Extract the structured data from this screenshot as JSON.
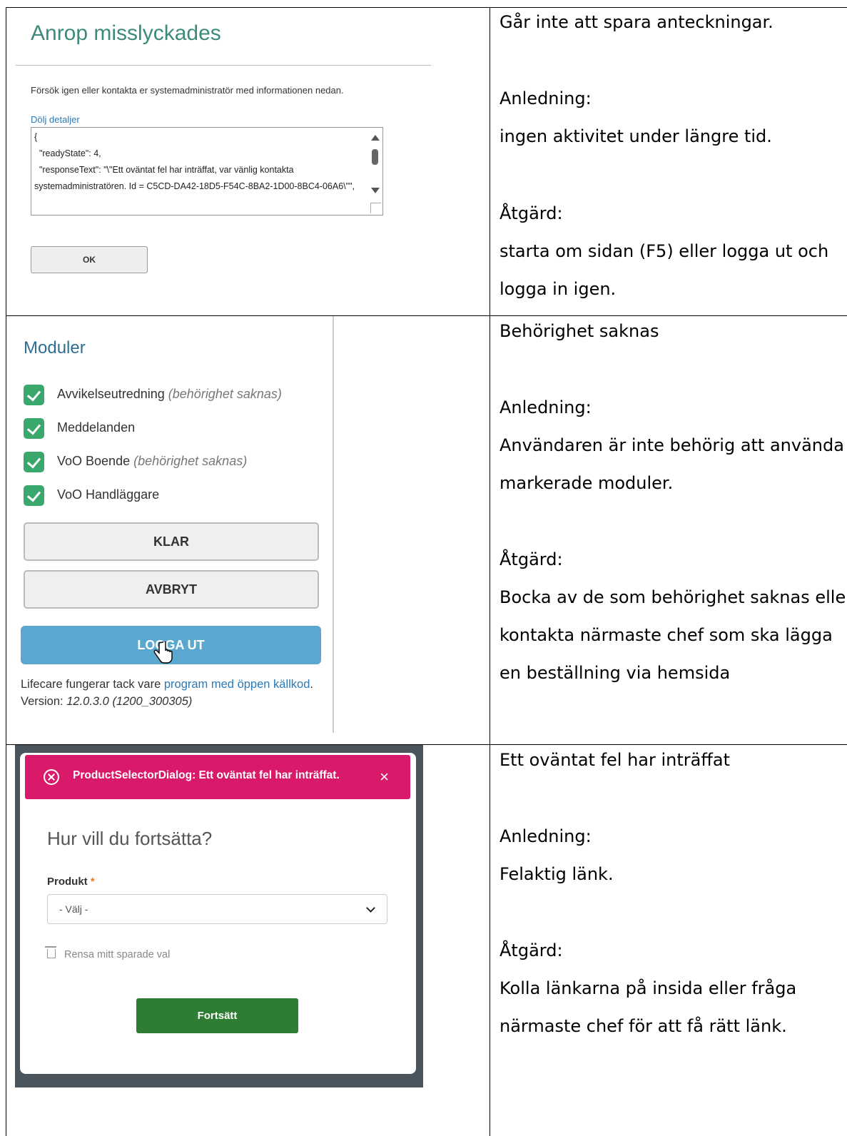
{
  "panel1": {
    "title": "Anrop misslyckades",
    "message": "Försök igen eller kontakta er systemadministratör med informationen nedan.",
    "details_link": "Dölj detaljer",
    "details_text": "{\n  \"readyState\": 4,\n  \"responseText\": \"\\\"Ett oväntat fel har inträffat, var vänlig kontakta systemadministratören. Id = C5CD-DA42-18D5-F54C-8BA2-1D00-8BC4-06A6\\\"\",",
    "ok_label": "OK"
  },
  "panel2": {
    "title": "Moduler",
    "modules": [
      {
        "name": "Avvikelseutredning",
        "note": "(behörighet saknas)"
      },
      {
        "name": "Meddelanden",
        "note": ""
      },
      {
        "name": "VoO Boende",
        "note": "(behörighet saknas)"
      },
      {
        "name": "VoO Handläggare",
        "note": ""
      }
    ],
    "done_label": "KLAR",
    "cancel_label": "AVBRYT",
    "logout_label": "LOGGA UT",
    "footer_prefix": "Lifecare fungerar tack vare ",
    "footer_link": "program med öppen källkod",
    "footer_suffix": ".",
    "version_label": "Version:",
    "version_value": "12.0.3.0 (1200_300305)"
  },
  "panel3": {
    "alert_text": "ProductSelectorDialog: Ett oväntat fel har inträffat.",
    "alert_close": "×",
    "heading": "Hur vill du fortsätta?",
    "product_label": "Produkt",
    "required_mark": "*",
    "select_value": "- Välj -",
    "clear_label": "Rensa mitt sparade val",
    "continue_label": "Fortsätt"
  },
  "right": {
    "row1": {
      "title": "Går inte att spara anteckningar.",
      "cause_label": "Anledning:",
      "cause": "ingen aktivitet under längre tid.",
      "action_label": "Åtgärd:",
      "action_1": "starta om sidan (F5) eller logga ut och",
      "action_2": "logga in igen."
    },
    "row2": {
      "title": "Behörighet saknas",
      "cause_label": "Anledning:",
      "cause_1": "Användaren är inte behörig att använda",
      "cause_2": "markerade moduler.",
      "action_label": "Åtgärd:",
      "action_1": "Bocka av de som behörighet saknas eller",
      "action_2": "kontakta närmaste chef som ska lägga",
      "action_3": "en beställning via hemsida"
    },
    "row3": {
      "title": "Ett oväntat fel har inträffat",
      "cause_label": "Anledning:",
      "cause": "Felaktig länk.",
      "action_label": "Åtgärd:",
      "action_1": "Kolla länkarna på insida eller fråga",
      "action_2": "närmaste chef för att få rätt länk."
    }
  }
}
